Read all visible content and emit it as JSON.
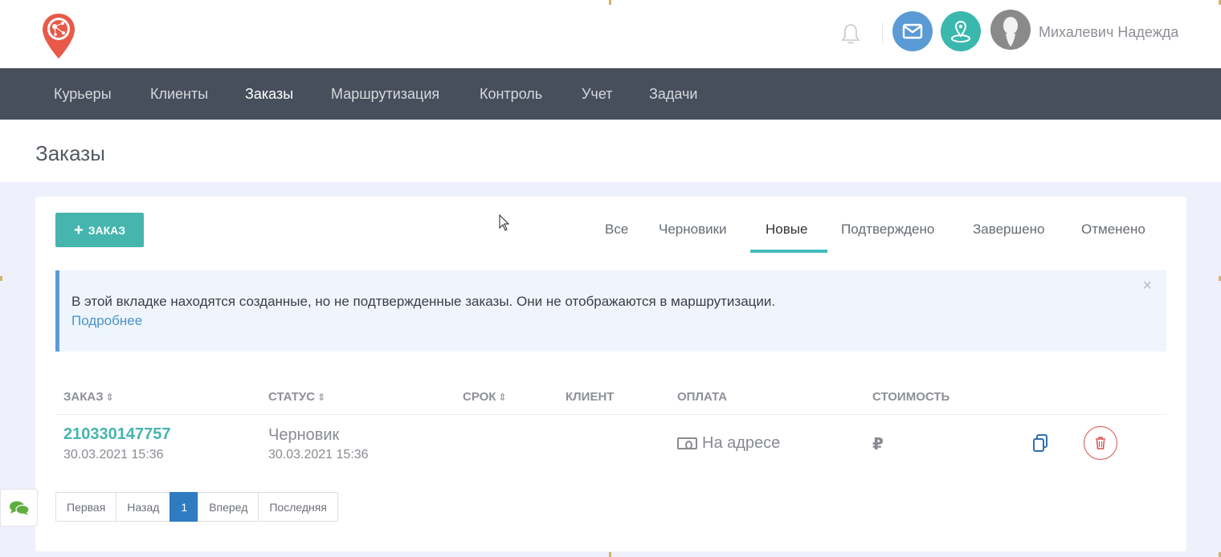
{
  "header": {
    "user_name": "Михалевич Надежда",
    "icons": {
      "logo": "map-pin-logo",
      "bell": "bell-icon",
      "mail": "envelope-icon",
      "map": "map-marker-icon",
      "avatar": "user-silhouette"
    },
    "colors": {
      "mail_bg": "#5b9bd5",
      "map_bg": "#3bb8ad",
      "logo": "#e8594a"
    }
  },
  "nav": {
    "items": [
      "Курьеры",
      "Клиенты",
      "Заказы",
      "Маршрутизация",
      "Контроль",
      "Учет",
      "Задачи"
    ],
    "active": "Заказы"
  },
  "page": {
    "title": "Заказы"
  },
  "toolbar": {
    "add_label": "ЗАКАЗ",
    "add_icon": "plus-icon",
    "tabs": [
      "Все",
      "Черновики",
      "Новые",
      "Подтверждено",
      "Завершено",
      "Отменено"
    ],
    "active_tab": "Новые"
  },
  "alert": {
    "text": "В этой вкладке находятся созданные, но не подтвержденные заказы. Они не отображаются в маршрутизации.",
    "link": "Подробнее",
    "close": "×"
  },
  "table": {
    "headers": {
      "order": "ЗАКАЗ",
      "status": "СТАТУС",
      "deadline": "СРОК",
      "client": "КЛИЕНТ",
      "payment": "ОПЛАТА",
      "cost": "СТОИМОСТЬ"
    },
    "rows": [
      {
        "order_number": "210330147757",
        "order_date": "30.03.2021 15:36",
        "status": "Черновик",
        "status_date": "30.03.2021 15:36",
        "deadline": "",
        "client": "",
        "payment": "На адресе",
        "cost": "₽"
      }
    ]
  },
  "pagination": {
    "first": "Первая",
    "prev": "Назад",
    "current": "1",
    "next": "Вперед",
    "last": "Последняя"
  },
  "chat": {
    "icon": "chat-bubbles-icon"
  }
}
